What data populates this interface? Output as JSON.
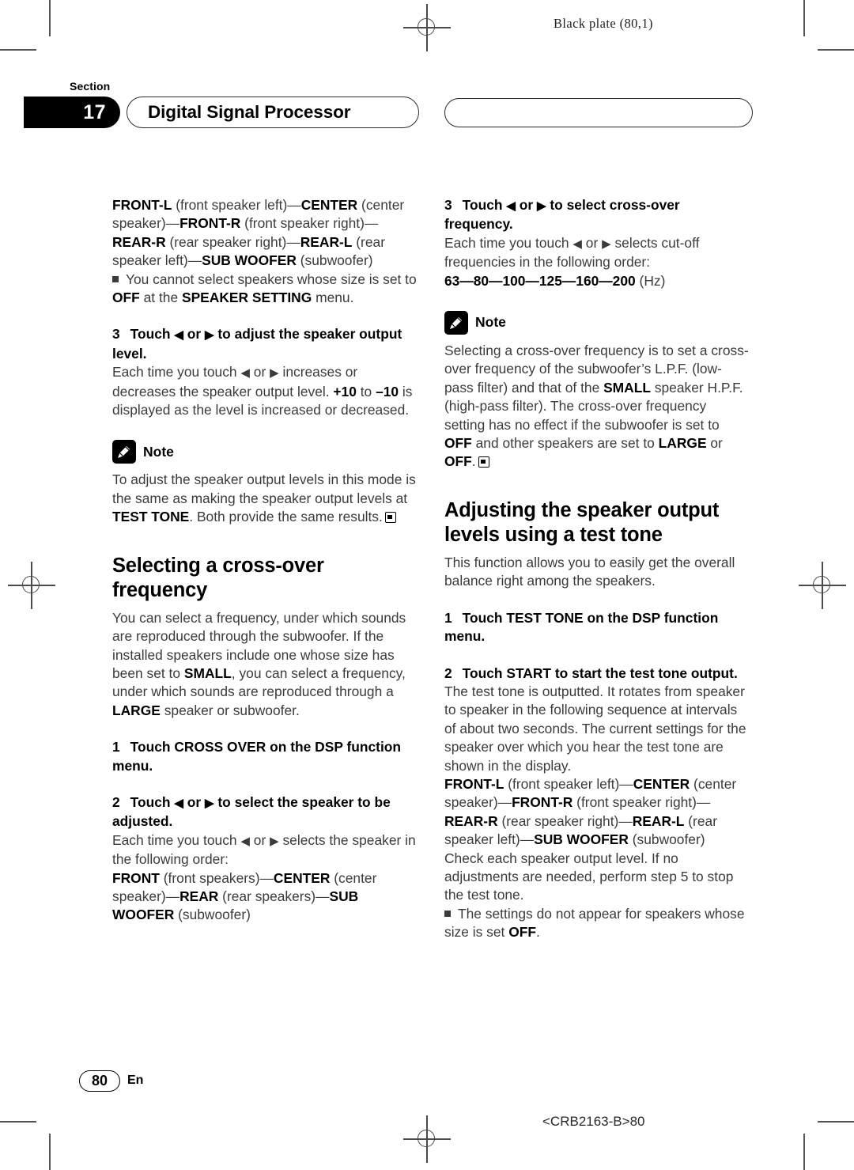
{
  "plate": {
    "note": "Black plate (80,1)"
  },
  "header": {
    "section_word": "Section",
    "section_number": "17",
    "section_title": "Digital Signal Processor"
  },
  "note_label": "Note",
  "left_column": {
    "speaker_order_para": {
      "p1_b1": "FRONT-L",
      "p1_t1": " (front speaker left)—",
      "p1_b2": "CENTER",
      "p1_t2": " (center speaker)—",
      "p1_b3": "FRONT-R",
      "p1_t3": " (front speaker right)—",
      "p1_b4": "REAR-R",
      "p1_t4": " (rear speaker right)—",
      "p1_b5": "REAR-L",
      "p1_t5": " (rear speaker left)—",
      "p1_b6": "SUB WOOFER",
      "p1_t6": " (subwoofer)"
    },
    "bullet_1": {
      "t1": "You cannot select speakers whose size is set to ",
      "b1": "OFF",
      "t2": " at the ",
      "b2": "SPEAKER SETTING",
      "t3": " menu."
    },
    "step3": {
      "num": "3",
      "label_a": "Touch ",
      "arrow_left": "◀",
      "label_b": " or ",
      "arrow_right": "▶",
      "label_c": " to adjust the speaker output level."
    },
    "step3_body": {
      "t1": "Each time you touch ",
      "a1": "◀",
      "t2": " or ",
      "a2": "▶",
      "t3": " increases or decreases the speaker output level. ",
      "b1": "+10",
      "t4": " to ",
      "b2": "–10",
      "t5": " is displayed as the level is increased or decreased."
    },
    "note_1": {
      "t1": "To adjust the speaker output levels in this mode is the same as making the speaker output levels at ",
      "b1": "TEST TONE",
      "t2": ". Both provide the same results."
    },
    "heading_crossover": "Selecting a cross-over frequency",
    "crossover_intro": {
      "t1": "You can select a frequency, under which sounds are reproduced through the subwoofer. If the installed speakers include one whose size has been set to ",
      "b1": "SMALL",
      "t2": ", you can select a frequency, under which sounds are reproduced through a ",
      "b2": "LARGE",
      "t3": " speaker or subwoofer."
    },
    "step1": {
      "num": "1",
      "label": "Touch CROSS OVER on the DSP function menu."
    },
    "step2": {
      "num": "2",
      "label_a": "Touch ",
      "arrow_left": "◀",
      "label_b": " or ",
      "arrow_right": "▶",
      "label_c": " to select the speaker to be adjusted."
    },
    "step2_body": {
      "t1": "Each time you touch ",
      "a1": "◀",
      "t2": " or ",
      "a2": "▶",
      "t3": " selects the speaker in the following order:"
    },
    "speaker_order_2": {
      "b1": "FRONT",
      "t1": " (front speakers)—",
      "b2": "CENTER",
      "t2": " (center speaker)—",
      "b3": "REAR",
      "t3": " (rear speakers)—",
      "b4": "SUB WOOFER",
      "t4": " (subwoofer)"
    }
  },
  "right_column": {
    "step3": {
      "num": "3",
      "label_a": "Touch ",
      "arrow_left": "◀",
      "label_b": " or ",
      "arrow_right": "▶",
      "label_c": " to select cross-over frequency."
    },
    "step3_body": {
      "t1": "Each time you touch ",
      "a1": "◀",
      "t2": " or ",
      "a2": "▶",
      "t3": " selects cut-off frequencies in the following order:"
    },
    "freq_list": {
      "b1": "63—80—100—125—160—200",
      "t1": " (Hz)"
    },
    "note_1": {
      "t1": "Selecting a cross-over frequency is to set a cross-over frequency of the subwoofer’s L.P.F. (low-pass filter) and that of the ",
      "b1": "SMALL",
      "t2": " speaker H.P.F. (high-pass filter). The cross-over frequency setting has no effect if the subwoofer is set to ",
      "b2": "OFF",
      "t3": " and other speakers are set to ",
      "b3": "LARGE",
      "t4": " or ",
      "b4": "OFF",
      "t5": "."
    },
    "heading_testtone": "Adjusting the speaker output levels using a test tone",
    "testtone_intro": "This function allows you to easily get the overall balance right among the speakers.",
    "step1": {
      "num": "1",
      "label": "Touch TEST TONE on the DSP function menu."
    },
    "step2": {
      "num": "2",
      "label": "Touch START to start the test tone output."
    },
    "step2_body": "The test tone is outputted. It rotates from speaker to speaker in the following sequence at intervals of about two seconds. The current settings for the speaker over which you hear the test tone are shown in the display.",
    "speaker_order_para": {
      "b1": "FRONT-L",
      "t1": " (front speaker left)—",
      "b2": "CENTER",
      "t2": " (center speaker)—",
      "b3": "FRONT-R",
      "t3": " (front speaker right)—",
      "b4": "REAR-R",
      "t4": " (rear speaker right)—",
      "b5": "REAR-L",
      "t5": " (rear speaker left)—",
      "b6": "SUB WOOFER",
      "t6": " (subwoofer)"
    },
    "check_para": "Check each speaker output level. If no adjustments are needed, perform step 5 to stop the test tone.",
    "bullet_1": {
      "t1": "The settings do not appear for speakers whose size is set ",
      "b1": "OFF",
      "t2": "."
    }
  },
  "footer": {
    "page_number": "80",
    "language": "En",
    "doc_code": "<CRB2163-B>80"
  }
}
